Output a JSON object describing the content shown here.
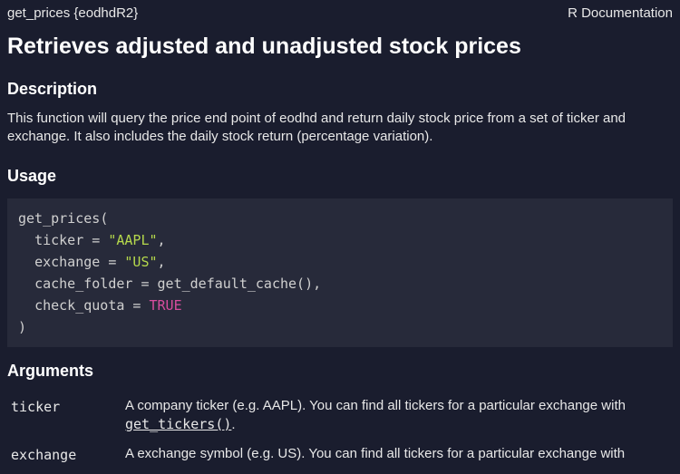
{
  "header": {
    "left": "get_prices {eodhdR2}",
    "right": "R Documentation"
  },
  "title": "Retrieves adjusted and unadjusted stock prices",
  "sections": {
    "description_heading": "Description",
    "description_text": "This function will query the price end point of eodhd and return daily stock price from a set of ticker and exchange. It also includes the daily stock return (percentage variation).",
    "usage_heading": "Usage",
    "arguments_heading": "Arguments"
  },
  "usage": {
    "fn": "get_prices",
    "open": "(",
    "close": ")",
    "params": {
      "ticker_key": "ticker",
      "ticker_val": "\"AAPL\"",
      "exchange_key": "exchange",
      "exchange_val": "\"US\"",
      "cache_key": "cache_folder",
      "cache_val": "get_default_cache()",
      "check_key": "check_quota",
      "check_val": "TRUE"
    }
  },
  "arguments": [
    {
      "name": "ticker",
      "desc_pre": "A company ticker (e.g. AAPL). You can find all tickers for a particular exchange with ",
      "link": "get_tickers()",
      "desc_post": "."
    },
    {
      "name": "exchange",
      "desc_pre": "A exchange symbol (e.g. US). You can find all tickers for a particular exchange with",
      "link": "",
      "desc_post": ""
    }
  ]
}
